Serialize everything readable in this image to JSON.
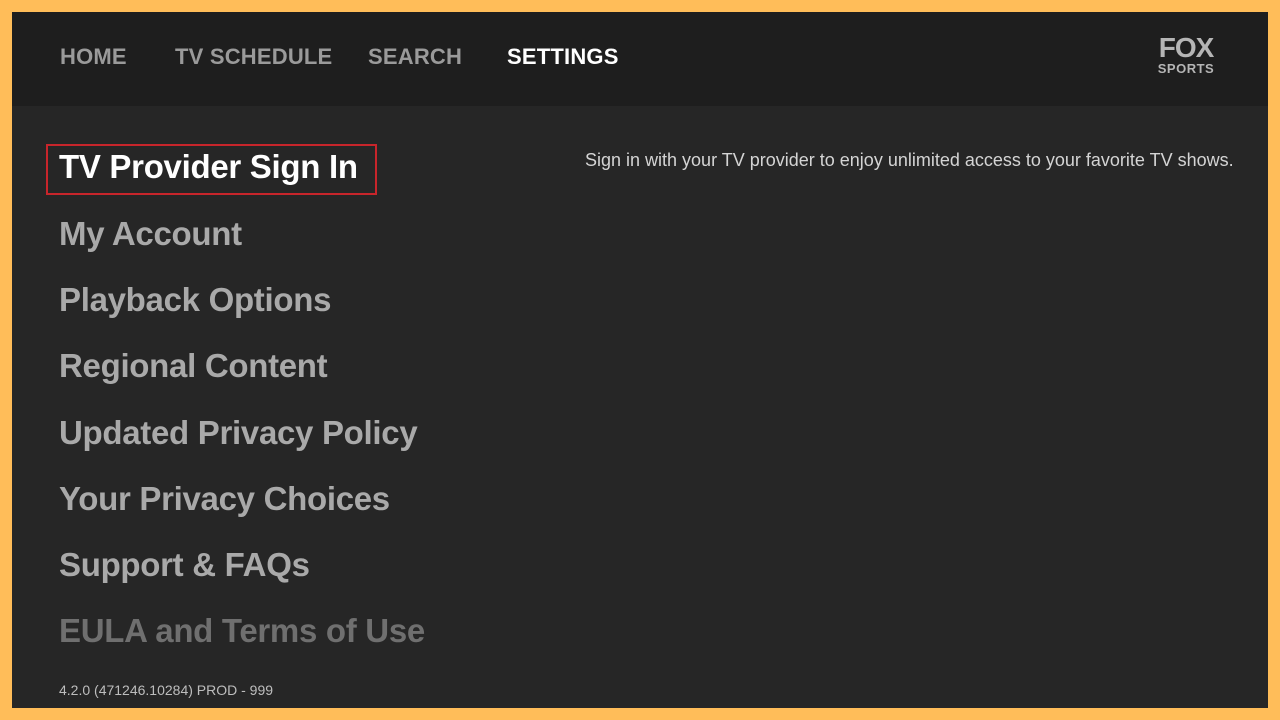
{
  "nav": {
    "items": [
      {
        "label": "HOME"
      },
      {
        "label": "TV SCHEDULE"
      },
      {
        "label": "SEARCH"
      },
      {
        "label": "SETTINGS",
        "active": true
      }
    ]
  },
  "logo": {
    "top": "FOX",
    "bottom": "SPORTS"
  },
  "settings_menu": {
    "items": [
      {
        "label": "TV Provider Sign In",
        "selected": true
      },
      {
        "label": "My Account"
      },
      {
        "label": "Playback Options"
      },
      {
        "label": "Regional Content"
      },
      {
        "label": "Updated Privacy Policy"
      },
      {
        "label": "Your Privacy Choices"
      },
      {
        "label": "Support & FAQs"
      },
      {
        "label": "EULA and Terms of Use"
      }
    ]
  },
  "description": "Sign in with your TV provider to enjoy unlimited access to your favorite TV shows.",
  "version": "4.2.0 (471246.10284) PROD - 999",
  "colors": {
    "frame": "#ffbd59",
    "background": "#262626",
    "nav_background": "#1e1e1e",
    "focus_border": "#c8252b"
  }
}
